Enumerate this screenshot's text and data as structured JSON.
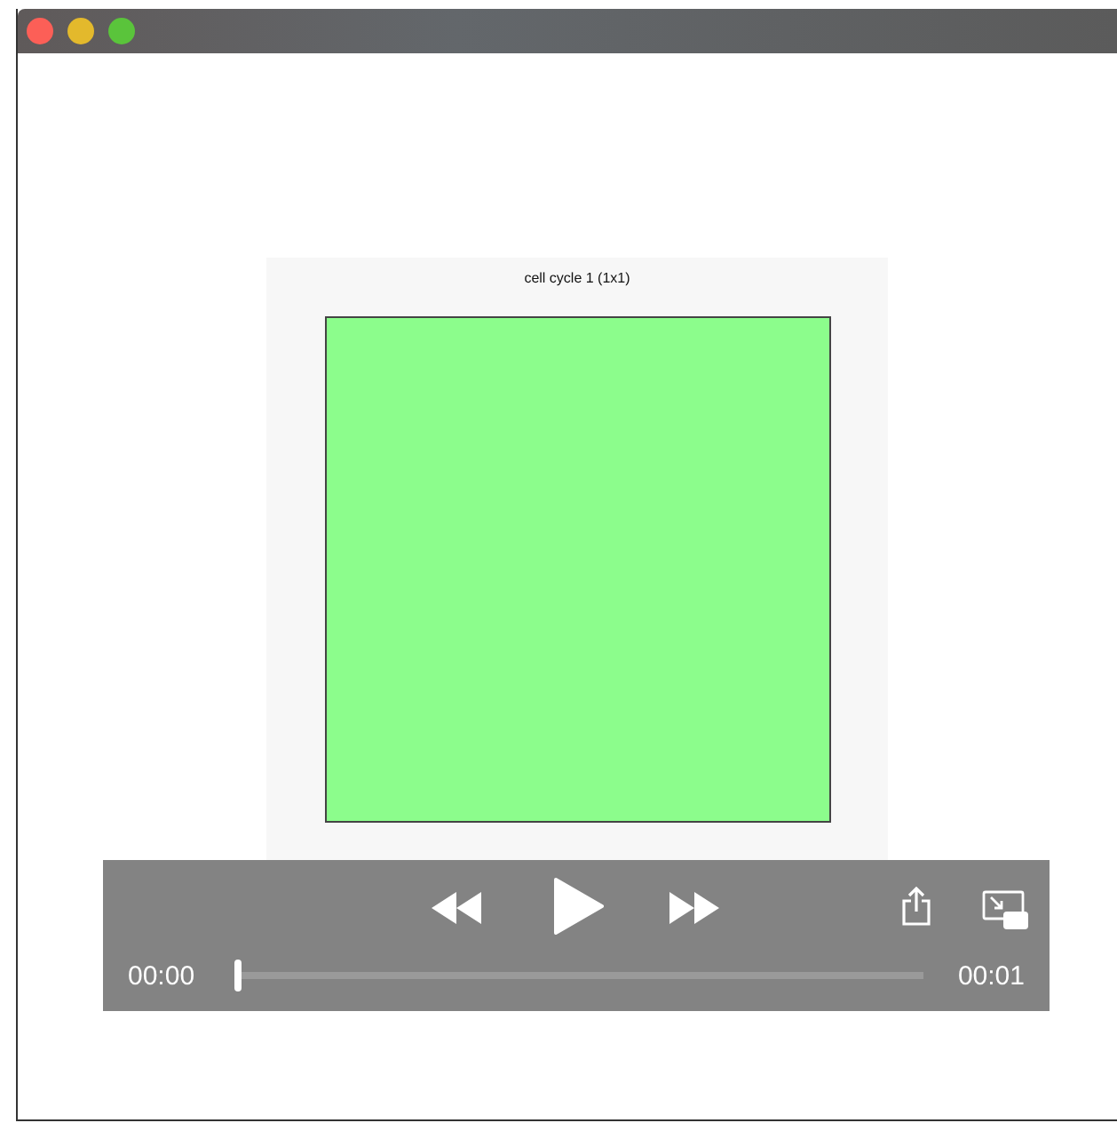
{
  "video": {
    "plot_title": "cell cycle 1 (1x1)"
  },
  "controls": {
    "elapsed": "00:00",
    "duration": "00:01",
    "playing": false,
    "level": 0
  }
}
